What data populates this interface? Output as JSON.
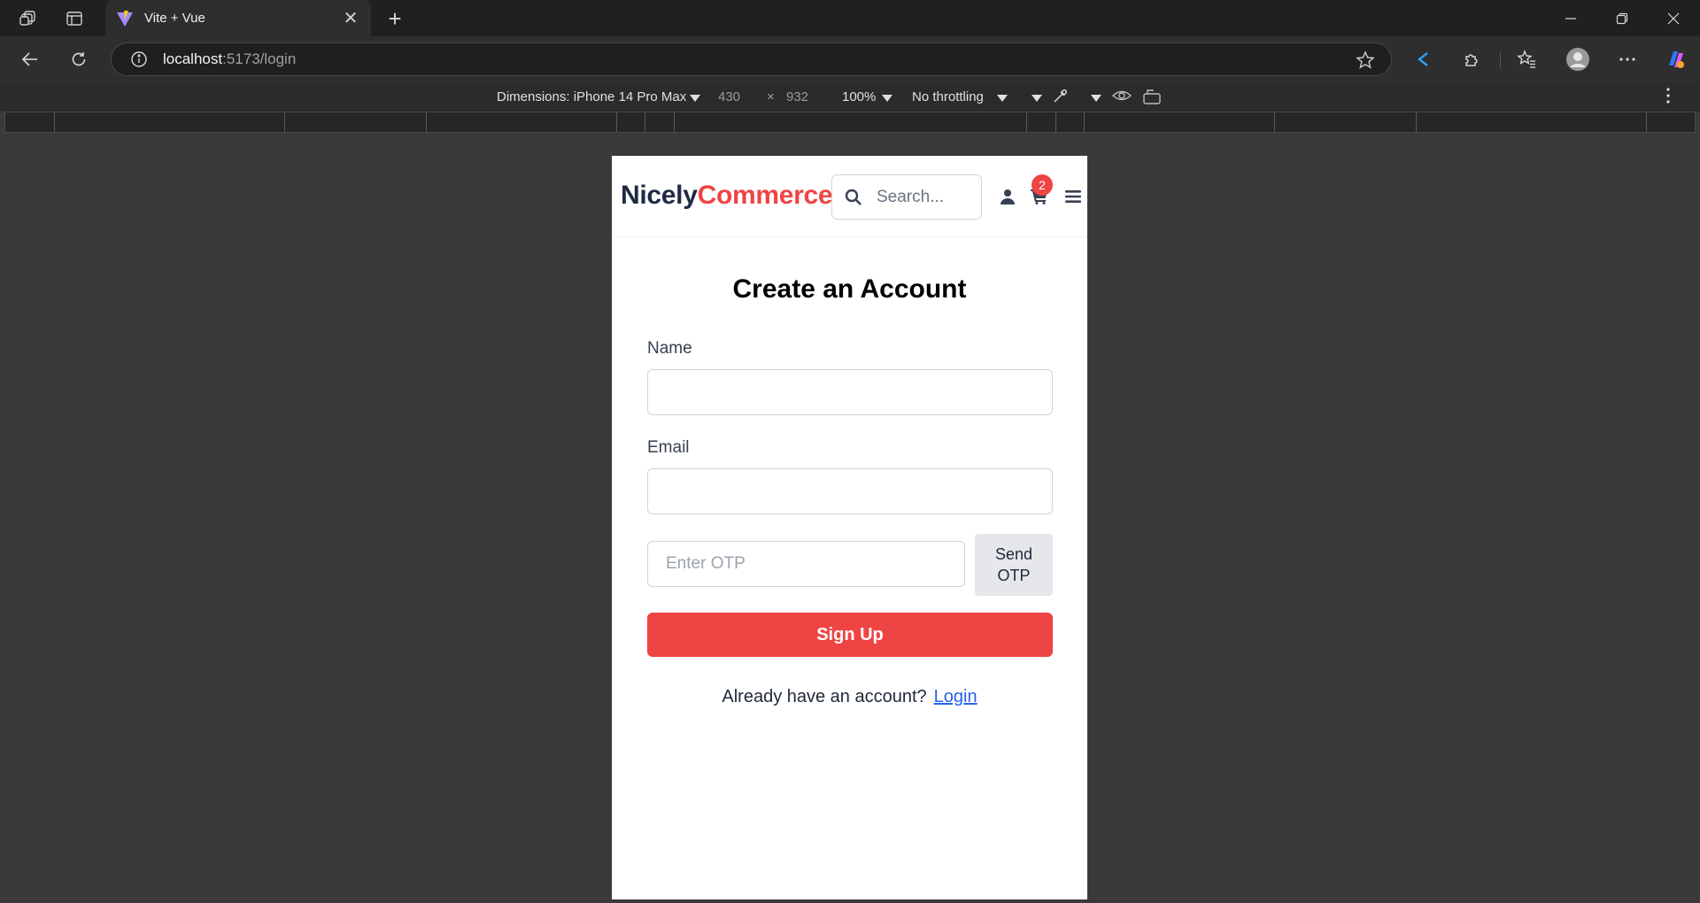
{
  "browser": {
    "tab_title": "Vite + Vue",
    "url_host": "localhost",
    "url_path": ":5173/login"
  },
  "devtools": {
    "dimensions_label": "Dimensions: iPhone 14 Pro Max",
    "width": "430",
    "times": "×",
    "height": "932",
    "zoom": "100%",
    "throttling": "No throttling"
  },
  "app": {
    "brand_primary": "Nicely",
    "brand_accent": "Commerce",
    "search_placeholder": "Search...",
    "cart_count": "2",
    "colors": {
      "accent": "#ef4444",
      "brand_dark": "#1f2a44",
      "link": "#2563eb"
    }
  },
  "form": {
    "title": "Create an Account",
    "name_label": "Name",
    "name_value": "",
    "email_label": "Email",
    "email_value": "",
    "otp_placeholder": "Enter OTP",
    "send_otp_line1": "Send",
    "send_otp_line2": "OTP",
    "signup_label": "Sign Up",
    "footer_text": "Already have an account?",
    "login_link": "Login"
  }
}
